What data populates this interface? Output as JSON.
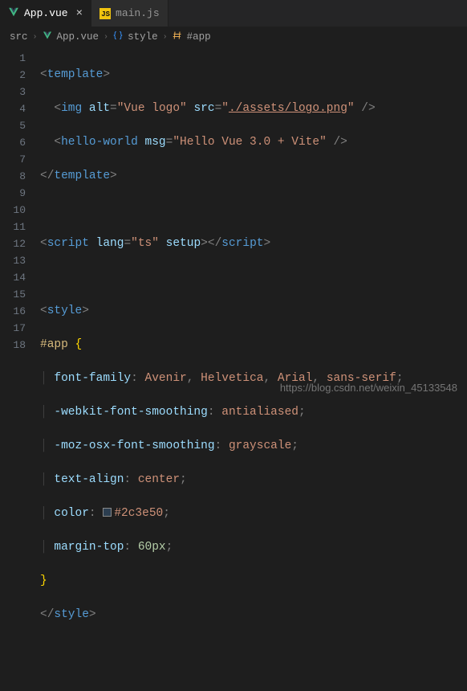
{
  "tabs": {
    "active": {
      "label": "App.vue"
    },
    "other": {
      "label": "main.js",
      "icon_text": "JS"
    }
  },
  "breadcrumbs": {
    "src": "src",
    "file": "App.vue",
    "style": "style",
    "app": "#app"
  },
  "lines": [
    "1",
    "2",
    "3",
    "4",
    "5",
    "6",
    "7",
    "8",
    "9",
    "10",
    "11",
    "12",
    "13",
    "14",
    "15",
    "16",
    "17",
    "18"
  ],
  "code": {
    "l1": {
      "lt": "<",
      "tag": "template",
      "gt": ">"
    },
    "l2": {
      "lt": "<",
      "tag": "img",
      "sp": " ",
      "a1": "alt",
      "eq": "=",
      "v1": "\"Vue logo\"",
      "a2": "src",
      "v2pre": "\"",
      "v2": "./assets/logo.png",
      "v2post": "\"",
      "end": " />"
    },
    "l3": {
      "lt": "<",
      "tag": "hello-world",
      "sp": " ",
      "a1": "msg",
      "eq": "=",
      "v1": "\"Hello Vue 3.0 + Vite\"",
      "end": " />"
    },
    "l4": {
      "lt": "</",
      "tag": "template",
      "gt": ">"
    },
    "l6": {
      "lt": "<",
      "tag": "script",
      "sp": " ",
      "a1": "lang",
      "eq": "=",
      "v1": "\"ts\"",
      "a2": "setup",
      "gt": ">",
      "lt2": "</",
      "gt2": ">"
    },
    "l8": {
      "lt": "<",
      "tag": "style",
      "gt": ">"
    },
    "l9": {
      "sel": "#app",
      "brace": "{"
    },
    "l10": {
      "prop": "font-family",
      "colon": ":",
      "v1": "Avenir",
      "c": ",",
      "v2": "Helvetica",
      "v3": "Arial",
      "v4": "sans-serif",
      "semi": ";"
    },
    "l11": {
      "prop": "-webkit-font-smoothing",
      "colon": ":",
      "val": "antialiased",
      "semi": ";"
    },
    "l12": {
      "prop": "-moz-osx-font-smoothing",
      "colon": ":",
      "val": "grayscale",
      "semi": ";"
    },
    "l13": {
      "prop": "text-align",
      "colon": ":",
      "val": "center",
      "semi": ";"
    },
    "l14": {
      "prop": "color",
      "colon": ":",
      "val": "#2c3e50",
      "semi": ";"
    },
    "l15": {
      "prop": "margin-top",
      "colon": ":",
      "num": "60px",
      "semi": ";"
    },
    "l16": {
      "brace": "}"
    },
    "l17": {
      "lt": "</",
      "tag": "style",
      "gt": ">"
    }
  },
  "watermark": "https://blog.csdn.net/weixin_45133548"
}
